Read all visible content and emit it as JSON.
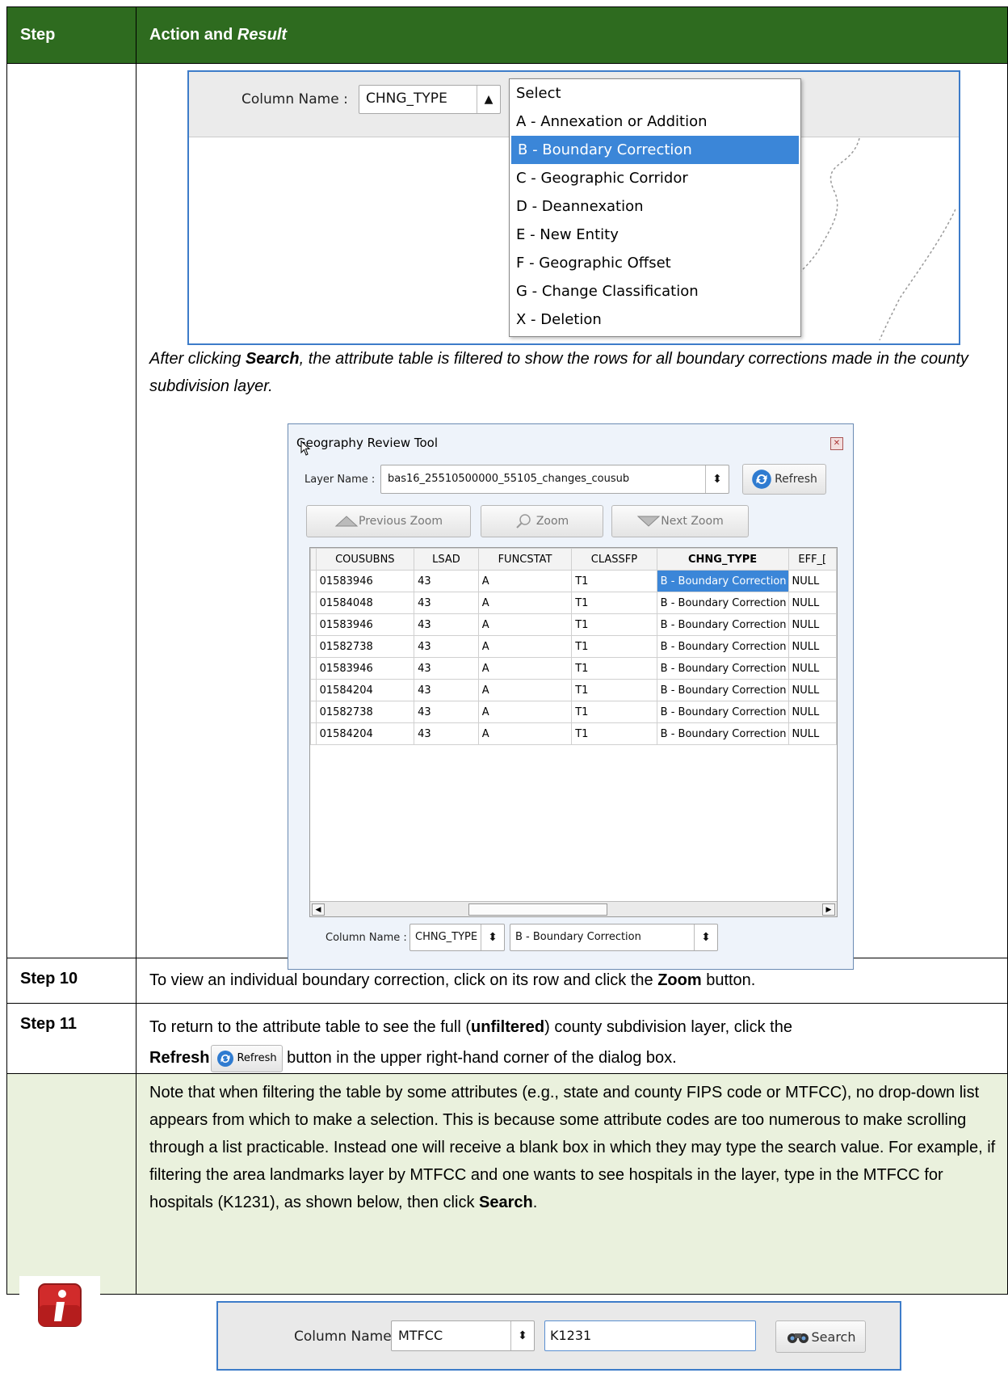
{
  "header": {
    "step": "Step",
    "action": "Action and",
    "result": "Result"
  },
  "shot1": {
    "column_label": "Column Name :",
    "column_value": "CHNG_TYPE",
    "options": [
      "Select",
      "A - Annexation or Addition",
      "B - Boundary Correction",
      "C - Geographic Corridor",
      "D - Deannexation",
      "E - New Entity",
      "F - Geographic Offset",
      "G - Change Classification",
      "X - Deletion"
    ],
    "selected_index": 2
  },
  "caption": {
    "pre": "After clicking ",
    "bold": "Search",
    "post": ", the attribute table is filtered to show the rows for all boundary corrections made in the county subdivision layer."
  },
  "dialog": {
    "title": "Geography Review Tool",
    "layer_label": "Layer Name :",
    "layer_value": "bas16_25510500000_55105_changes_cousub",
    "refresh": "Refresh",
    "prev_zoom": "Previous Zoom",
    "zoom": "Zoom",
    "next_zoom": "Next Zoom",
    "columns": [
      "COUSUBNS",
      "LSAD",
      "FUNCSTAT",
      "CLASSFP",
      "CHNG_TYPE",
      "EFF_["
    ],
    "rows": [
      [
        "01583946",
        "43",
        "A",
        "T1",
        "B - Boundary Correction",
        "NULL"
      ],
      [
        "01584048",
        "43",
        "A",
        "T1",
        "B - Boundary Correction",
        "NULL"
      ],
      [
        "01583946",
        "43",
        "A",
        "T1",
        "B - Boundary Correction",
        "NULL"
      ],
      [
        "01582738",
        "43",
        "A",
        "T1",
        "B - Boundary Correction",
        "NULL"
      ],
      [
        "01583946",
        "43",
        "A",
        "T1",
        "B - Boundary Correction",
        "NULL"
      ],
      [
        "01584204",
        "43",
        "A",
        "T1",
        "B - Boundary Correction",
        "NULL"
      ],
      [
        "01582738",
        "43",
        "A",
        "T1",
        "B - Boundary Correction",
        "NULL"
      ],
      [
        "01584204",
        "43",
        "A",
        "T1",
        "B - Boundary Correction",
        "NULL"
      ]
    ],
    "column_label": "Column Name :",
    "column_value": "CHNG_TYPE",
    "filter_value": "B - Boundary Correction"
  },
  "step10": {
    "label": "Step 10",
    "pre": "To view an individual boundary correction, click on its row and click the ",
    "bold": "Zoom",
    "post": " button."
  },
  "step11": {
    "label": "Step 11",
    "t1": "To return to the attribute table to see the full (",
    "b1": "unfiltered",
    "t2": ") county subdivision layer, click the",
    "b2": "Refresh",
    "btn": "Refresh",
    "t3": " button in the upper right-hand corner of the dialog box."
  },
  "note": {
    "text": "Note that when filtering the table by some attributes (e.g., state and county FIPS code or MTFCC), no drop-down list appears from which to make a selection. This is because some attribute codes are too numerous to make scrolling through a list practicable. Instead one will receive a blank box in which they may type the search value. For example, if filtering the area landmarks layer by MTFCC and one wants to see hospitals in the layer, type in the MTFCC for hospitals (K1231), as shown below, then click ",
    "bold": "Search",
    "end": "."
  },
  "shot3": {
    "column_label": "Column Name :",
    "column_value": "MTFCC",
    "input_value": "K1231",
    "search": "Search"
  }
}
